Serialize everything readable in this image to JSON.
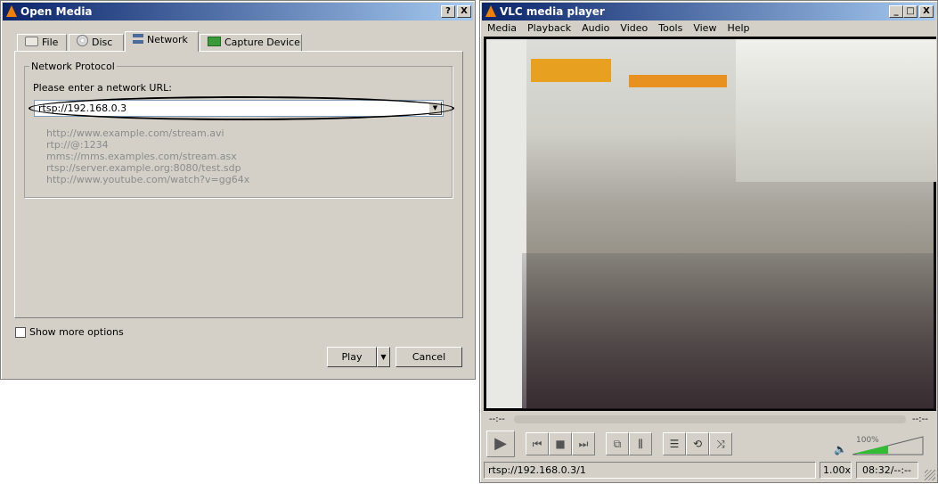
{
  "open_media": {
    "title": "Open Media",
    "help_btn": "?",
    "close_btn": "X",
    "tabs": [
      {
        "label": "File"
      },
      {
        "label": "Disc"
      },
      {
        "label": "Network"
      },
      {
        "label": "Capture Device"
      }
    ],
    "group_title": "Network Protocol",
    "url_label": "Please enter a network URL:",
    "url_value": "rtsp://192.168.0.3",
    "examples": [
      "http://www.example.com/stream.avi",
      "rtp://@:1234",
      "mms://mms.examples.com/stream.asx",
      "rtsp://server.example.org:8080/test.sdp",
      "http://www.youtube.com/watch?v=gg64x"
    ],
    "show_more": "Show more options",
    "play": "Play",
    "cancel": "Cancel"
  },
  "vlc": {
    "title": "VLC media player",
    "minimize": "_",
    "maximize": "□",
    "close": "X",
    "menu": [
      "Media",
      "Playback",
      "Audio",
      "Video",
      "Tools",
      "View",
      "Help"
    ],
    "elapsed": "--:--",
    "remaining": "--:--",
    "volume_label": "100%",
    "volume": 1.0,
    "status_url": "rtsp://192.168.0.3/1",
    "speed": "1.00x",
    "time": "08:32/--:--"
  }
}
